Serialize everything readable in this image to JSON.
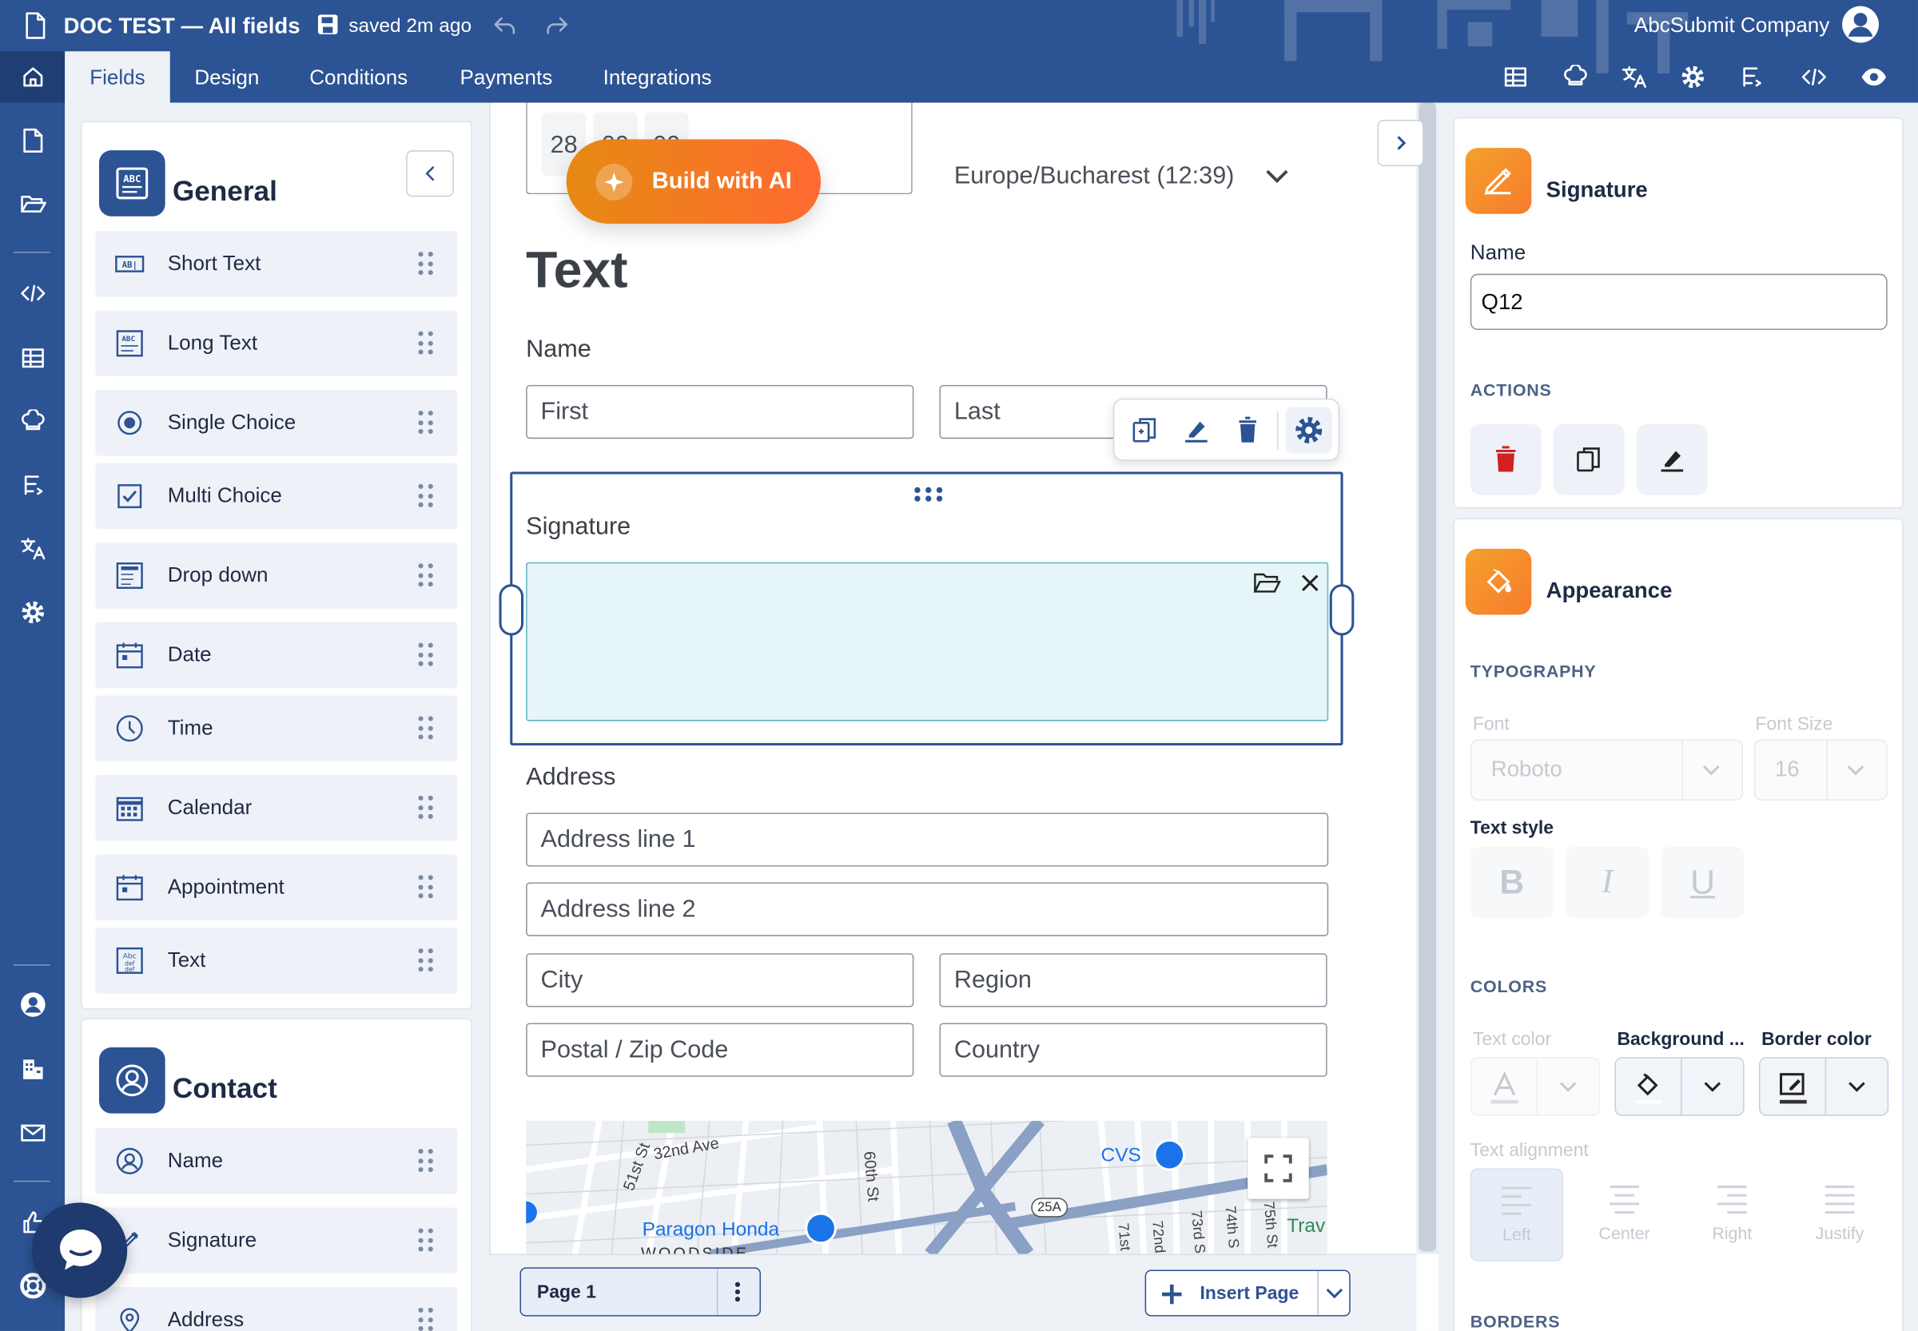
{
  "colors": {
    "brand": "#2c5393",
    "accent_orange": "#f4892c",
    "signature_fill": "#e6f5f8",
    "delete_red": "#d32020"
  },
  "header": {
    "doc_title": "DOC TEST — All fields",
    "save_status": "saved 2m ago",
    "company": "AbcSubmit Company",
    "tabs": [
      {
        "label": "Fields",
        "active": true
      },
      {
        "label": "Design"
      },
      {
        "label": "Conditions"
      },
      {
        "label": "Payments"
      },
      {
        "label": "Integrations"
      }
    ],
    "tools": [
      "table-icon",
      "chef-hat-icon",
      "translate-icon",
      "gear-icon",
      "flow-icon",
      "code-icon",
      "eye-icon"
    ]
  },
  "left_rail": {
    "items": [
      "document-icon",
      "folder-open-icon",
      "code-icon",
      "table-icon",
      "chef-hat-icon",
      "flow-icon",
      "translate-icon",
      "gear-icon",
      "account-icon",
      "building-icon",
      "mail-icon",
      "thumb-icon",
      "lifebuoy-icon"
    ]
  },
  "palette": {
    "general": {
      "title": "General",
      "items": [
        {
          "label": "Short Text",
          "icon": "short-text-icon"
        },
        {
          "label": "Long Text",
          "icon": "long-text-icon"
        },
        {
          "label": "Single Choice",
          "icon": "radio-icon"
        },
        {
          "label": "Multi Choice",
          "icon": "checkbox-icon"
        },
        {
          "label": "Drop down",
          "icon": "dropdown-icon"
        },
        {
          "label": "Date",
          "icon": "date-icon"
        },
        {
          "label": "Time",
          "icon": "clock-icon"
        },
        {
          "label": "Calendar",
          "icon": "calendar-icon"
        },
        {
          "label": "Appointment",
          "icon": "appointment-icon"
        },
        {
          "label": "Text",
          "icon": "text-block-icon"
        }
      ]
    },
    "contact": {
      "title": "Contact",
      "items": [
        {
          "label": "Name",
          "icon": "person-icon"
        },
        {
          "label": "Signature",
          "icon": "pen-icon"
        },
        {
          "label": "Address",
          "icon": "location-icon"
        }
      ]
    }
  },
  "canvas": {
    "time_partial": {
      "hour": "28",
      "min": "00",
      "sec": "00"
    },
    "timezone": "Europe/Bucharest (12:39)",
    "ai_button": "Build with AI",
    "text_heading": "Text",
    "name_field": {
      "label": "Name",
      "first_placeholder": "First",
      "last_placeholder": "Last"
    },
    "signature_field": {
      "label": "Signature"
    },
    "address_field": {
      "label": "Address",
      "line1": "Address line 1",
      "line2": "Address line 2",
      "city": "City",
      "region": "Region",
      "postal": "Postal / Zip Code",
      "country": "Country"
    },
    "map": {
      "labels": [
        "32nd Ave",
        "51st St",
        "60th St",
        "CVS",
        "Paragon Honda",
        "25A",
        "71st",
        "72nd",
        "73rd S",
        "74th S",
        "75th St",
        "Trav",
        "WOODSIDE"
      ]
    },
    "page_tab": "Page 1",
    "insert_page": "Insert Page"
  },
  "properties": {
    "signature": {
      "title": "Signature",
      "name_label": "Name",
      "name_value": "Q12",
      "actions_caption": "ACTIONS"
    },
    "appearance": {
      "title": "Appearance",
      "typography_caption": "TYPOGRAPHY",
      "font_label": "Font",
      "font_value": "Roboto",
      "font_size_label": "Font Size",
      "font_size_value": "16",
      "text_style_label": "Text style",
      "style_buttons": [
        "B",
        "I",
        "U"
      ],
      "colors_caption": "COLORS",
      "text_color_label": "Text color",
      "background_label": "Background ...",
      "border_color_label": "Border color",
      "text_alignment_label": "Text alignment",
      "alignments": [
        "Left",
        "Center",
        "Right",
        "Justify"
      ],
      "borders_caption": "BORDERS"
    }
  }
}
